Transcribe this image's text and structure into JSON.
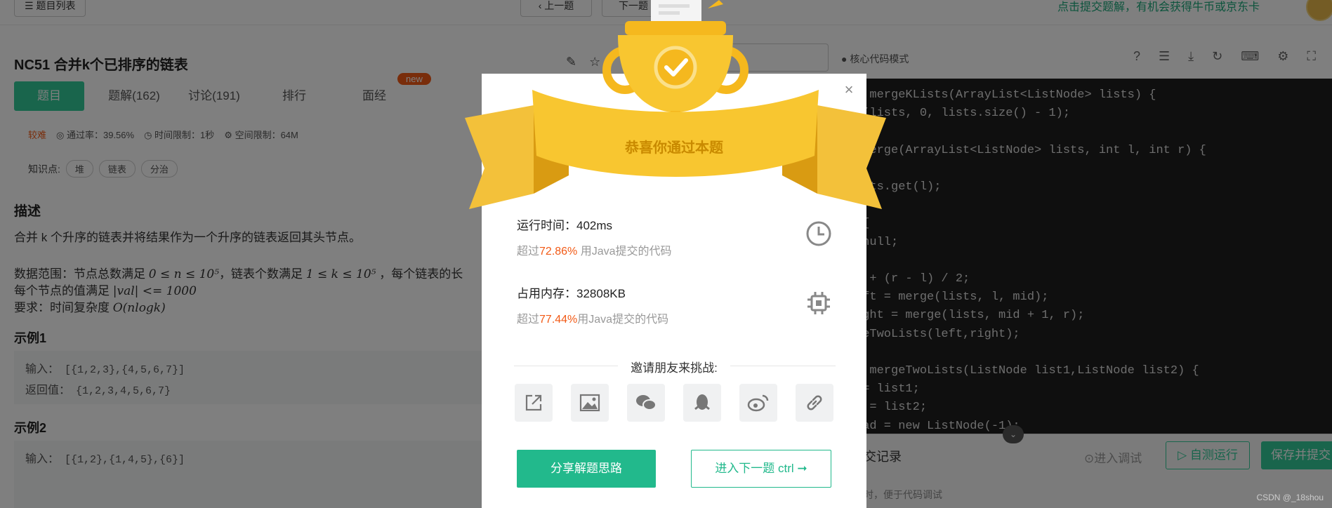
{
  "topbar": {
    "problem_list": "☰ 题目列表",
    "prev": "‹ 上一题",
    "next": "下一题",
    "promo": "点击提交题解，有机会获得牛币或京东卡"
  },
  "problem": {
    "title": "NC51  合并k个已排序的链表",
    "tabs": [
      "题目",
      "题解(162)",
      "讨论(191)",
      "排行",
      "面经"
    ],
    "new_badge": "new",
    "difficulty": "较难",
    "pass_rate": "通过率：39.56%",
    "time_limit": "时间限制：1秒",
    "space_limit": "空间限制：64M",
    "knowledge_label": "知识点:",
    "knowledge_tags": [
      "堆",
      "链表",
      "分治"
    ],
    "desc_heading": "描述",
    "desc_line1": "合并 k 个升序的链表并将结果作为一个升序的链表返回其头节点。",
    "range_prefix": "数据范围：节点总数满足 ",
    "range_math1": "0 ≤ n ≤ 10⁵",
    "range_mid": "，链表个数满足 ",
    "range_math2": "1 ≤ k ≤ 10⁵",
    "range_suffix": " ，每个链表的长",
    "val_prefix": "每个节点的值满足 ",
    "val_math": "|val| <= 1000",
    "req_prefix": "要求：时间复杂度 ",
    "req_math": "O(nlogk)",
    "example1_heading": "示例1",
    "example1_input_label": "输入：",
    "example1_input": "[{1,2,3},{4,5,6,7}]",
    "example1_output_label": "返回值：",
    "example1_output": "{1,2,3,4,5,6,7}",
    "example2_heading": "示例2",
    "example2_input_label": "输入：",
    "example2_input": "[{1,2},{1,4,5},{6}]"
  },
  "editor": {
    "mode": "● 核心代码模式",
    "lines": [
      {
        "text": "e mergeKLists(ArrayList<ListNode> lists) {"
      },
      {
        "text": "e(lists, 0, lists.size() - 1);"
      },
      {
        "text": ""
      },
      {
        "text": " merge(ArrayList<ListNode> lists, int l, int r) {"
      },
      {
        "text": "{"
      },
      {
        "text": "ists.get(l);"
      },
      {
        "text": ""
      },
      {
        "text": " {"
      },
      {
        "text": " null;"
      },
      {
        "text": ""
      },
      {
        "text": "l + (r - l) / 2;"
      },
      {
        "text": "eft = merge(lists, l, mid);"
      },
      {
        "text": "ight = merge(lists, mid + 1, r);"
      },
      {
        "text": "geTwoLists(left,right);"
      },
      {
        "text": ""
      },
      {
        "text": "e mergeTwoLists(ListNode list1,ListNode list2) {"
      },
      {
        "text": "1= list1;"
      },
      {
        "text": "2 = list2;"
      },
      {
        "text": "ead = new ListNode(-1);"
      }
    ]
  },
  "bottom": {
    "submit_record": "交记录",
    "debug": "⊙进入调试",
    "self_test": "▷ 自测运行",
    "save_submit": "保存并提交",
    "hint": "时，便于代码调试"
  },
  "modal": {
    "congrats": "恭喜你通过本题",
    "runtime_label": "运行时间：402ms",
    "runtime_pre": "超过",
    "runtime_pct": "72.86%",
    "runtime_post": " 用Java提交的代码",
    "memory_label": "占用内存：32808KB",
    "memory_pre": "超过",
    "memory_pct": "77.44%",
    "memory_post": "用Java提交的代码",
    "invite": "邀请朋友来挑战:",
    "share_idea": "分享解题思路",
    "next_problem": "进入下一题 ctrl ➞"
  },
  "watermark": "CSDN @_18shou",
  "colors": {
    "accent": "#32ca99",
    "orange": "#f25a16",
    "gold": "#f5b81e"
  }
}
